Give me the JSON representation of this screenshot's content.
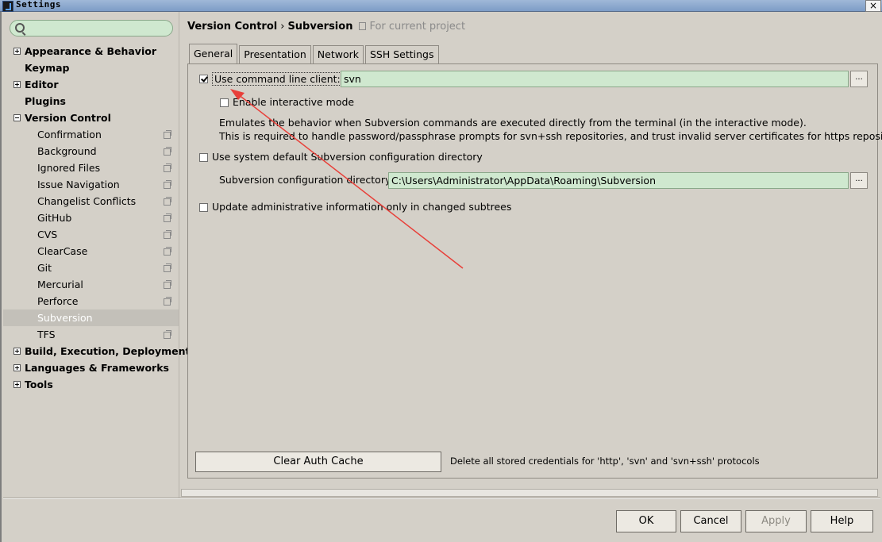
{
  "window": {
    "title": "Settings",
    "close_glyph": "×"
  },
  "search": {
    "value": "",
    "placeholder": ""
  },
  "sidebar": {
    "items": [
      {
        "label": "Appearance & Behavior",
        "level": "top",
        "expander": "plus"
      },
      {
        "label": "Keymap",
        "level": "top",
        "expander": "none"
      },
      {
        "label": "Editor",
        "level": "top",
        "expander": "plus"
      },
      {
        "label": "Plugins",
        "level": "top",
        "expander": "none"
      },
      {
        "label": "Version Control",
        "level": "top",
        "expander": "minus"
      },
      {
        "label": "Confirmation",
        "level": "child",
        "project": true
      },
      {
        "label": "Background",
        "level": "child",
        "project": true
      },
      {
        "label": "Ignored Files",
        "level": "child",
        "project": true
      },
      {
        "label": "Issue Navigation",
        "level": "child",
        "project": true
      },
      {
        "label": "Changelist Conflicts",
        "level": "child",
        "project": true
      },
      {
        "label": "GitHub",
        "level": "child",
        "project": true
      },
      {
        "label": "CVS",
        "level": "child",
        "project": true
      },
      {
        "label": "ClearCase",
        "level": "child",
        "project": true
      },
      {
        "label": "Git",
        "level": "child",
        "project": true
      },
      {
        "label": "Mercurial",
        "level": "child",
        "project": true
      },
      {
        "label": "Perforce",
        "level": "child",
        "project": true
      },
      {
        "label": "Subversion",
        "level": "child",
        "project": false,
        "selected": true
      },
      {
        "label": "TFS",
        "level": "child",
        "project": true
      },
      {
        "label": "Build, Execution, Deployment",
        "level": "top",
        "expander": "plus"
      },
      {
        "label": "Languages & Frameworks",
        "level": "top",
        "expander": "plus"
      },
      {
        "label": "Tools",
        "level": "top",
        "expander": "plus"
      }
    ]
  },
  "breadcrumb": {
    "parent": "Version Control",
    "separator": "›",
    "current": "Subversion",
    "note": "For current project"
  },
  "tabs": [
    {
      "label": "General",
      "active": true
    },
    {
      "label": "Presentation"
    },
    {
      "label": "Network"
    },
    {
      "label": "SSH Settings"
    }
  ],
  "general": {
    "use_cmd_client": {
      "label": "Use command line client:",
      "checked": true,
      "value": "svn"
    },
    "interactive_mode": {
      "label": "Enable interactive mode",
      "checked": false
    },
    "desc_line1": "Emulates the behavior when Subversion commands are executed directly from the terminal (in the interactive mode).",
    "desc_line2": "This is required to handle password/passphrase prompts for svn+ssh repositories, and trust invalid server certificates for https repositories.",
    "system_default_dir": {
      "label": "Use system default Subversion configuration directory",
      "checked": false
    },
    "config_dir": {
      "label": "Subversion configuration directory:",
      "value": "C:\\Users\\Administrator\\AppData\\Roaming\\Subversion"
    },
    "update_admin": {
      "label": "Update administrative information only in changed subtrees",
      "checked": false
    },
    "browse_glyph": "...",
    "clear_cache_button": "Clear Auth Cache",
    "clear_cache_note": "Delete all stored credentials for 'http', 'svn' and 'svn+ssh' protocols"
  },
  "footer": {
    "ok": "OK",
    "cancel": "Cancel",
    "apply": "Apply",
    "help": "Help"
  },
  "colors": {
    "field_bg": "#cfe8cf",
    "window_bg": "#d4d0c8",
    "selected_bg": "#c3c0b9",
    "annotation_arrow": "#e8403a"
  }
}
